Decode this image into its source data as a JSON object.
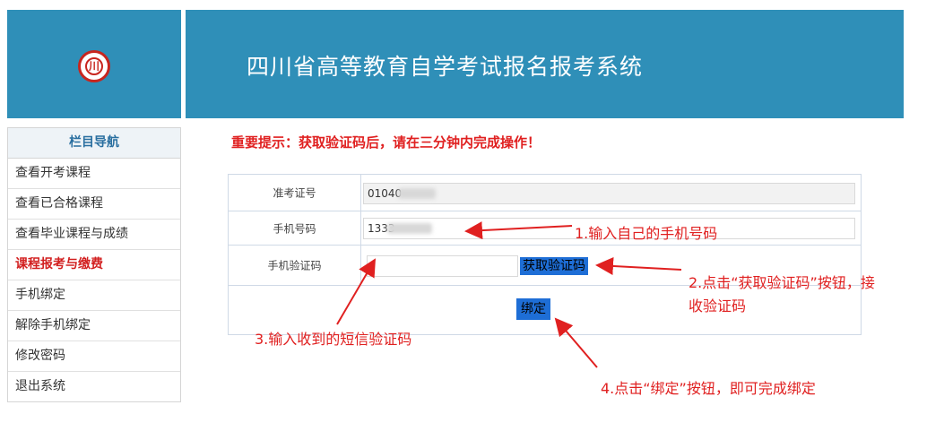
{
  "header": {
    "title": "四川省高等教育自学考试报名报考系统"
  },
  "sidebar": {
    "title": "栏目导航",
    "items": [
      {
        "label": "查看开考课程"
      },
      {
        "label": "查看已合格课程"
      },
      {
        "label": "查看毕业课程与成绩"
      },
      {
        "label": "课程报考与缴费"
      },
      {
        "label": "手机绑定"
      },
      {
        "label": "解除手机绑定"
      },
      {
        "label": "修改密码"
      },
      {
        "label": "退出系统"
      }
    ],
    "active_index": 3
  },
  "notice": "重要提示：获取验证码后，请在三分钟内完成操作！",
  "form": {
    "exam_id_label": "准考证号",
    "exam_id_value": "01040",
    "phone_label": "手机号码",
    "phone_value": "1333",
    "code_label": "手机验证码",
    "code_value": "",
    "get_code_button": "获取验证码",
    "bind_button": "绑定"
  },
  "annotations": {
    "step1": "1.输入自己的手机号码",
    "step2_line1": "2.点击“获取验证码”按钮，接",
    "step2_line2": "收验证码",
    "step3": "3.输入收到的短信验证码",
    "step4": "4.点击“绑定”按钮，即可完成绑定"
  },
  "colors": {
    "header_bg": "#2f8fb8",
    "accent_red": "#e02020",
    "button_blue": "#1e6ed6"
  }
}
